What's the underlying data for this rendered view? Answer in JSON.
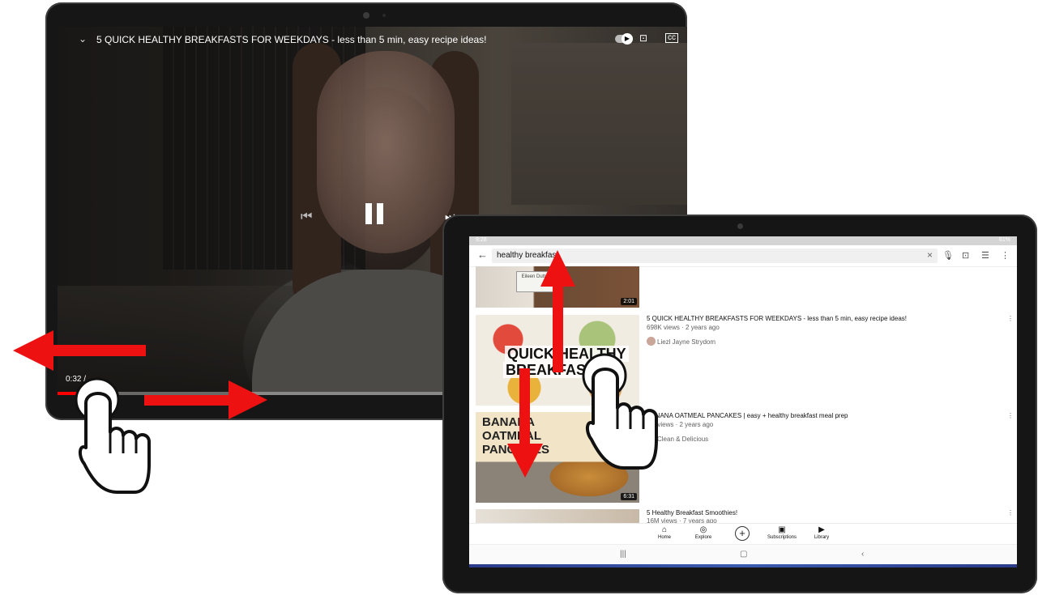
{
  "video_player": {
    "title": "5 QUICK HEALTHY BREAKFASTS FOR WEEKDAYS - less than 5 min, easy recipe ideas!",
    "current_time": "0:32 /",
    "progress_fraction": 0.05
  },
  "search_app": {
    "status_bar": {
      "time": "9:28",
      "battery": "61%"
    },
    "search_query": "healthy breakfast",
    "results": [
      {
        "title": "",
        "duration": "2:01",
        "thumb_caption": "Eileen Dutter"
      },
      {
        "title": "5 QUICK HEALTHY BREAKFASTS FOR WEEKDAYS - less than 5 min, easy recipe ideas!",
        "meta": "698K views · 2 years ago",
        "channel": "Liezl Jayne Strydom",
        "thumb_text_line1": "QUICK HEALTHY",
        "thumb_text_line2": "BREAKFAST I"
      },
      {
        "title": "BANANA OATMEAL PANCAKES | easy + healthy breakfast meal prep",
        "meta": "1M views · 2 years ago",
        "channel": "Clean & Delicious",
        "duration": "6:31",
        "thumb_text": "BANANA OATMEAL PANCAKES"
      },
      {
        "title": "5 Healthy Breakfast Smoothies!",
        "meta": "16M views · 7 years ago"
      }
    ],
    "bottom_nav": {
      "home": "Home",
      "explore": "Explore",
      "subscriptions": "Subscriptions",
      "library": "Library"
    }
  },
  "colors": {
    "gesture_arrow": "#ee1111",
    "progress": "#ff0000",
    "tablet_body": "#161616"
  },
  "icons": [
    "chevron-down-icon",
    "autoplay-toggle-icon",
    "cast-icon",
    "captions-icon",
    "more-vert-icon",
    "previous-icon",
    "pause-icon",
    "next-icon",
    "back-arrow-icon",
    "clear-icon",
    "mic-icon",
    "filter-icon",
    "home-icon",
    "explore-icon",
    "add-icon",
    "subscriptions-icon",
    "library-icon",
    "hand-pointer-icon",
    "arrow-left-icon",
    "arrow-right-icon",
    "arrow-up-icon",
    "arrow-down-icon"
  ]
}
